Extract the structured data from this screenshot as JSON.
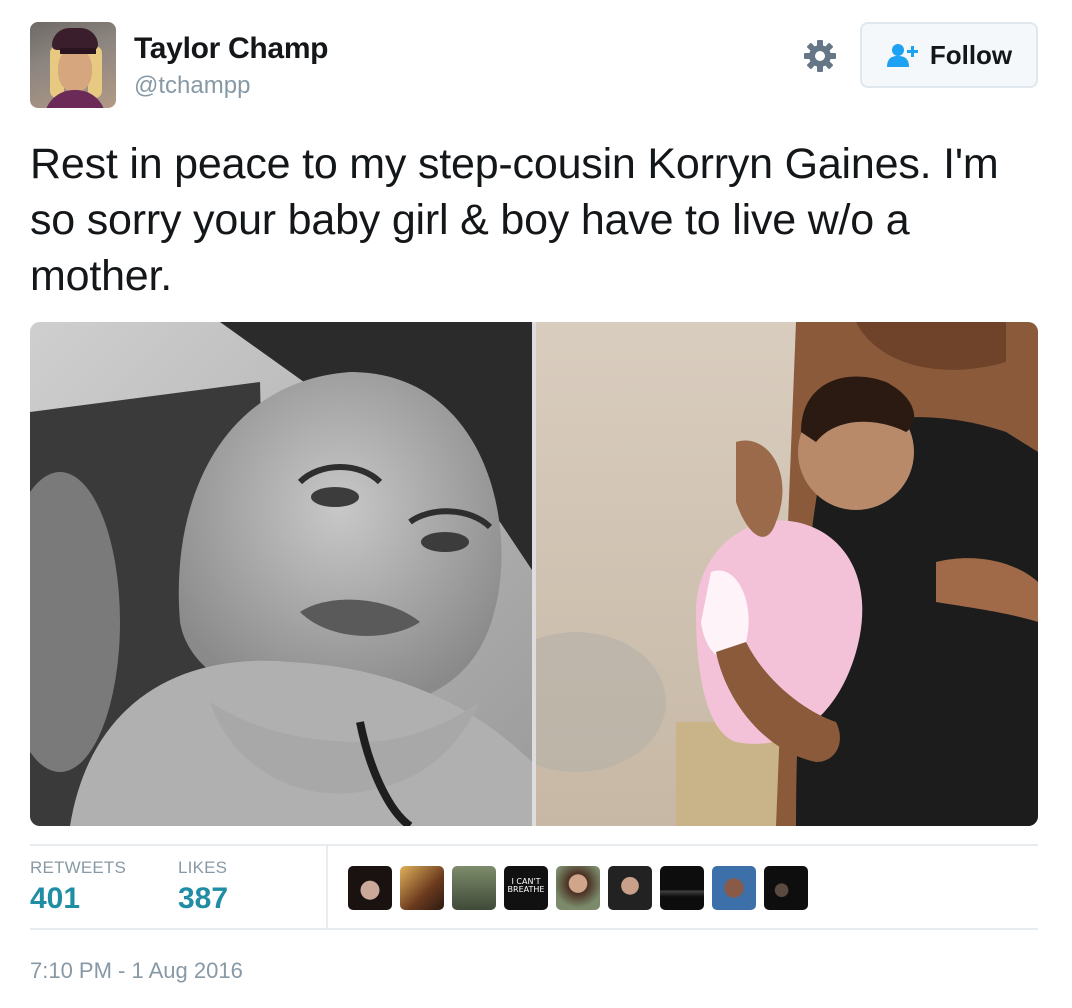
{
  "user": {
    "name": "Taylor Champ",
    "handle": "@tchampp",
    "avatar_icon": "profile-photo"
  },
  "actions": {
    "settings_icon": "gear-icon",
    "follow_label": "Follow",
    "follow_icon": "add-user-icon"
  },
  "tweet": {
    "text": "Rest in peace to my step-cousin Korryn Gaines. I'm so sorry your baby girl & boy have to live w/o a mother."
  },
  "media": {
    "count": 2,
    "items": [
      "black-and-white-selfie-photo",
      "mother-holding-baby-photo"
    ]
  },
  "stats": {
    "retweets_label": "RETWEETS",
    "retweets_value": "401",
    "likes_label": "LIKES",
    "likes_value": "387",
    "liker_avatars": [
      {
        "text": ""
      },
      {
        "text": ""
      },
      {
        "text": ""
      },
      {
        "text": "I CAN'T BREATHE"
      },
      {
        "text": ""
      },
      {
        "text": ""
      },
      {
        "text": ""
      },
      {
        "text": ""
      },
      {
        "text": ""
      }
    ]
  },
  "timestamp": "7:10 PM - 1 Aug 2016",
  "colors": {
    "accent": "#1f8da3",
    "muted": "#8899a6",
    "follow_icon": "#1da1f2"
  }
}
